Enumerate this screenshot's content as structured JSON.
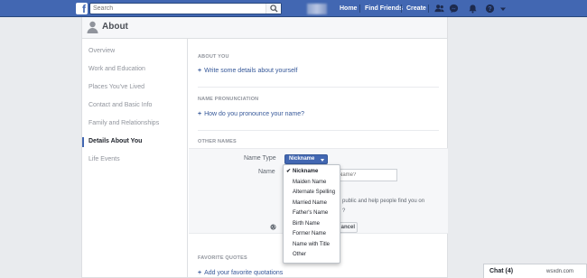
{
  "topbar": {
    "logo": "f",
    "search_placeholder": "Search",
    "nav": {
      "home": "Home",
      "find_friends": "Find Friends",
      "create": "Create"
    },
    "icons": [
      "friends-icon",
      "messenger-icon",
      "notifications-icon",
      "help-icon",
      "chevron-down-icon"
    ]
  },
  "header": {
    "title": "About"
  },
  "sidebar": {
    "items": [
      {
        "label": "Overview"
      },
      {
        "label": "Work and Education"
      },
      {
        "label": "Places You've Lived"
      },
      {
        "label": "Contact and Basic Info"
      },
      {
        "label": "Family and Relationships"
      },
      {
        "label": "Details About You",
        "active": true
      },
      {
        "label": "Life Events"
      }
    ]
  },
  "main": {
    "about_you": {
      "title": "ABOUT YOU",
      "link": "Write some details about yourself"
    },
    "pronunciation": {
      "title": "NAME PRONUNCIATION",
      "link": "How do you pronounce your name?"
    },
    "other_names": {
      "title": "OTHER NAMES",
      "name_type_label": "Name Type",
      "name_type_value": "Nickname",
      "name_label": "Name",
      "name_placeholder": "Name?",
      "help_line1": "public and help people find you on",
      "help_line2": "?",
      "cancel_label": "ancel"
    },
    "favorite_quotes": {
      "title": "FAVORITE QUOTES",
      "link": "Add your favorite quotations"
    }
  },
  "dropdown": {
    "options": [
      {
        "label": "Nickname",
        "selected": true
      },
      {
        "label": "Maiden Name"
      },
      {
        "label": "Alternate Spelling"
      },
      {
        "label": "Married Name"
      },
      {
        "label": "Father's Name"
      },
      {
        "label": "Birth Name"
      },
      {
        "label": "Former Name"
      },
      {
        "label": "Name with Title"
      },
      {
        "label": "Other"
      }
    ],
    "check": "✔"
  },
  "chat": {
    "label": "Chat (4)"
  },
  "watermark": "wsxdn.com",
  "colors": {
    "brand": "#4267b2",
    "link": "#365899",
    "background": "#e9ebee"
  }
}
